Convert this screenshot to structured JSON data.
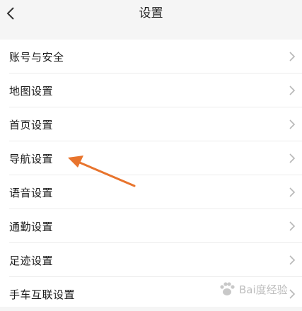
{
  "header": {
    "title": "设置"
  },
  "settings": [
    {
      "label": "账号与安全"
    },
    {
      "label": "地图设置"
    },
    {
      "label": "首页设置"
    },
    {
      "label": "导航设置"
    },
    {
      "label": "语音设置"
    },
    {
      "label": "通勤设置"
    },
    {
      "label": "足迹设置"
    },
    {
      "label": "手车互联设置"
    }
  ],
  "annotation": {
    "color": "#e8742d"
  },
  "watermark": {
    "text": "Bai度经验"
  },
  "icons": {
    "back": "chevron-left-icon",
    "row_chevron": "chevron-right-icon"
  }
}
